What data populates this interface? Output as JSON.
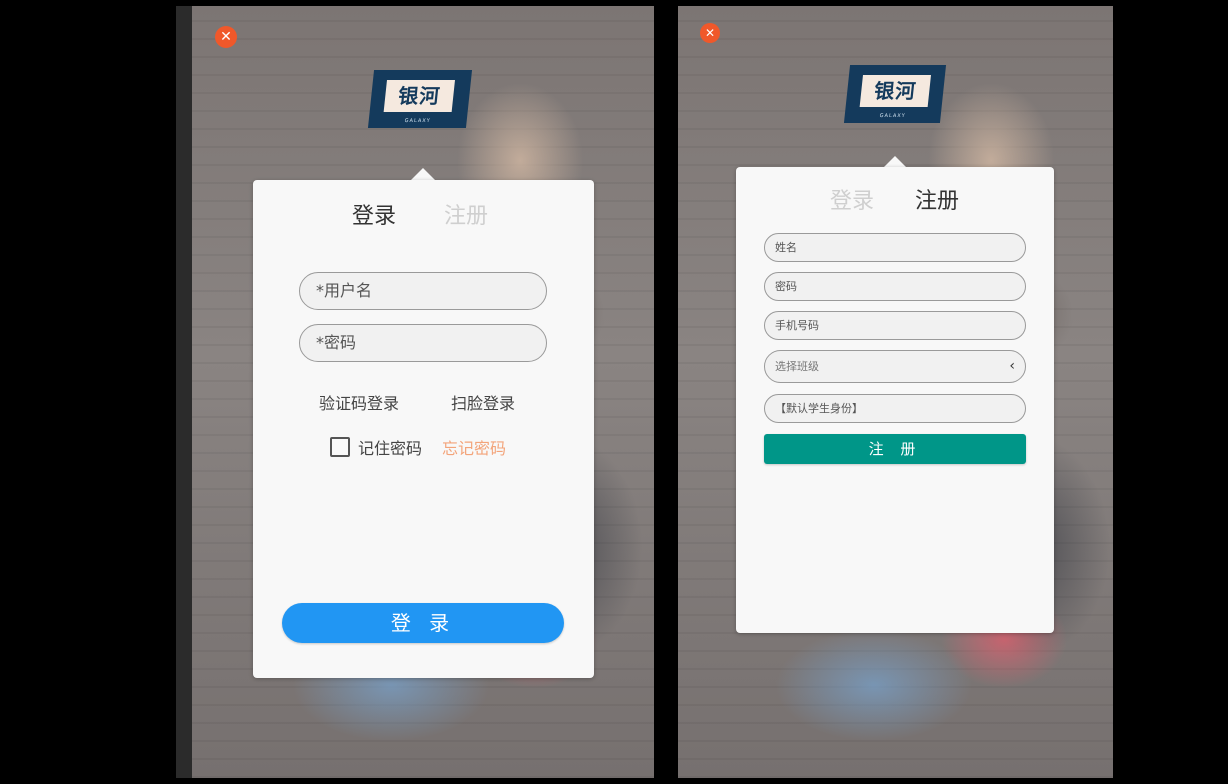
{
  "colors": {
    "close": "#f0582a",
    "login_button": "#2196f3",
    "register_button": "#009688",
    "forgot_link": "#f3a47a",
    "logo_bg": "#143a5c"
  },
  "logo": {
    "text": "银河",
    "subtext": "GALAXY"
  },
  "close_icon": "close-icon",
  "login_screen": {
    "tabs": {
      "login": "登录",
      "register": "注册"
    },
    "username_placeholder": "*用户名",
    "password_placeholder": "*密码",
    "sms_login": "验证码登录",
    "face_login": "扫脸登录",
    "remember_label": "记住密码",
    "forgot_label": "忘记密码",
    "submit": "登 录"
  },
  "register_screen": {
    "tabs": {
      "login": "登录",
      "register": "注册"
    },
    "name_placeholder": "姓名",
    "password_placeholder": "密码",
    "phone_placeholder": "手机号码",
    "class_placeholder": "选择班级",
    "role_placeholder": "【默认学生身份】",
    "submit": "注 册"
  }
}
